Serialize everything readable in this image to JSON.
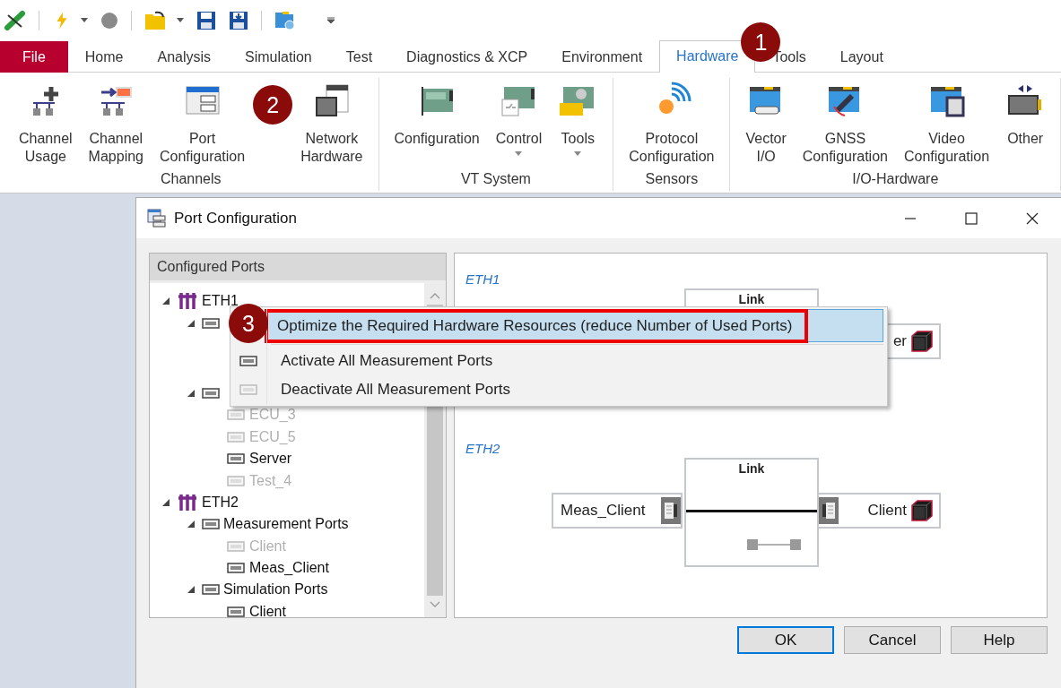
{
  "ribbon_tabs": [
    {
      "label": "File",
      "kind": "file",
      "selected": false
    },
    {
      "label": "Home",
      "kind": "tab",
      "selected": false
    },
    {
      "label": "Analysis",
      "kind": "tab",
      "selected": false
    },
    {
      "label": "Simulation",
      "kind": "tab",
      "selected": false
    },
    {
      "label": "Test",
      "kind": "tab",
      "selected": false
    },
    {
      "label": "Diagnostics & XCP",
      "kind": "tab",
      "selected": false
    },
    {
      "label": "Environment",
      "kind": "tab",
      "selected": false
    },
    {
      "label": "Hardware",
      "kind": "tab",
      "selected": true,
      "callout": "1"
    },
    {
      "label": "Tools",
      "kind": "tab",
      "selected": false
    },
    {
      "label": "Layout",
      "kind": "tab",
      "selected": false
    }
  ],
  "ribbon_groups": [
    {
      "label": "Channels",
      "buttons": [
        {
          "label": "Channel\nUsage"
        },
        {
          "label": "Channel\nMapping"
        },
        {
          "label": "Port\nConfiguration",
          "callout": "2"
        },
        {
          "label": "Network\nHardware"
        }
      ]
    },
    {
      "label": "VT System",
      "buttons": [
        {
          "label": "Configuration"
        },
        {
          "label": "Control",
          "dropdown": true
        },
        {
          "label": "Tools",
          "dropdown": true
        }
      ]
    },
    {
      "label": "Sensors",
      "buttons": [
        {
          "label": "Protocol\nConfiguration"
        }
      ]
    },
    {
      "label": "I/O-Hardware",
      "buttons": [
        {
          "label": "Vector\nI/O"
        },
        {
          "label": "GNSS\nConfiguration"
        },
        {
          "label": "Video\nConfiguration"
        },
        {
          "label": "Other"
        }
      ]
    }
  ],
  "dialog": {
    "title": "Port Configuration",
    "ports_header": "Configured Ports",
    "tree": [
      {
        "label": "ETH1",
        "kind": "bus",
        "expanded": true,
        "children": [
          {
            "kind": "folder",
            "expanded": true
          },
          {
            "kind": "folder",
            "expanded": true,
            "children": [
              {
                "label": "ECU_3",
                "kind": "port",
                "active": false
              },
              {
                "label": "ECU_5",
                "kind": "port",
                "active": false
              },
              {
                "label": "Server",
                "kind": "port",
                "active": true
              },
              {
                "label": "Test_4",
                "kind": "port",
                "active": false
              }
            ]
          }
        ]
      },
      {
        "label": "ETH2",
        "kind": "bus",
        "expanded": true,
        "children": [
          {
            "label": "Measurement Ports",
            "kind": "folder",
            "expanded": true,
            "children": [
              {
                "label": "Client",
                "kind": "port",
                "active": false
              },
              {
                "label": "Meas_Client",
                "kind": "port",
                "active": true
              }
            ]
          },
          {
            "label": "Simulation Ports",
            "kind": "folder",
            "expanded": true,
            "children": [
              {
                "label": "Client",
                "kind": "port",
                "active": true
              }
            ]
          }
        ]
      }
    ],
    "diagram": [
      {
        "label": "ETH1",
        "link_title": "Link",
        "right_node": {
          "label": "er"
        }
      },
      {
        "label": "ETH2",
        "link_title": "Link",
        "connected": true,
        "left_node": {
          "label": "Meas_Client",
          "port": true
        },
        "right_node": {
          "label": "Client",
          "port": true
        }
      }
    ],
    "buttons": [
      {
        "label": "OK",
        "default": true
      },
      {
        "label": "Cancel",
        "default": false
      },
      {
        "label": "Help",
        "default": false
      }
    ]
  },
  "context_menu": {
    "items": [
      {
        "label": "Optimize the Required Hardware Resources (reduce Number of Used Ports)",
        "selected": true,
        "callout": "3",
        "outlined": true,
        "separator_after": true
      },
      {
        "label": "Activate All Measurement Ports",
        "selected": false,
        "icon_active": true
      },
      {
        "label": "Deactivate All Measurement Ports",
        "selected": false,
        "icon_active": false
      }
    ]
  }
}
